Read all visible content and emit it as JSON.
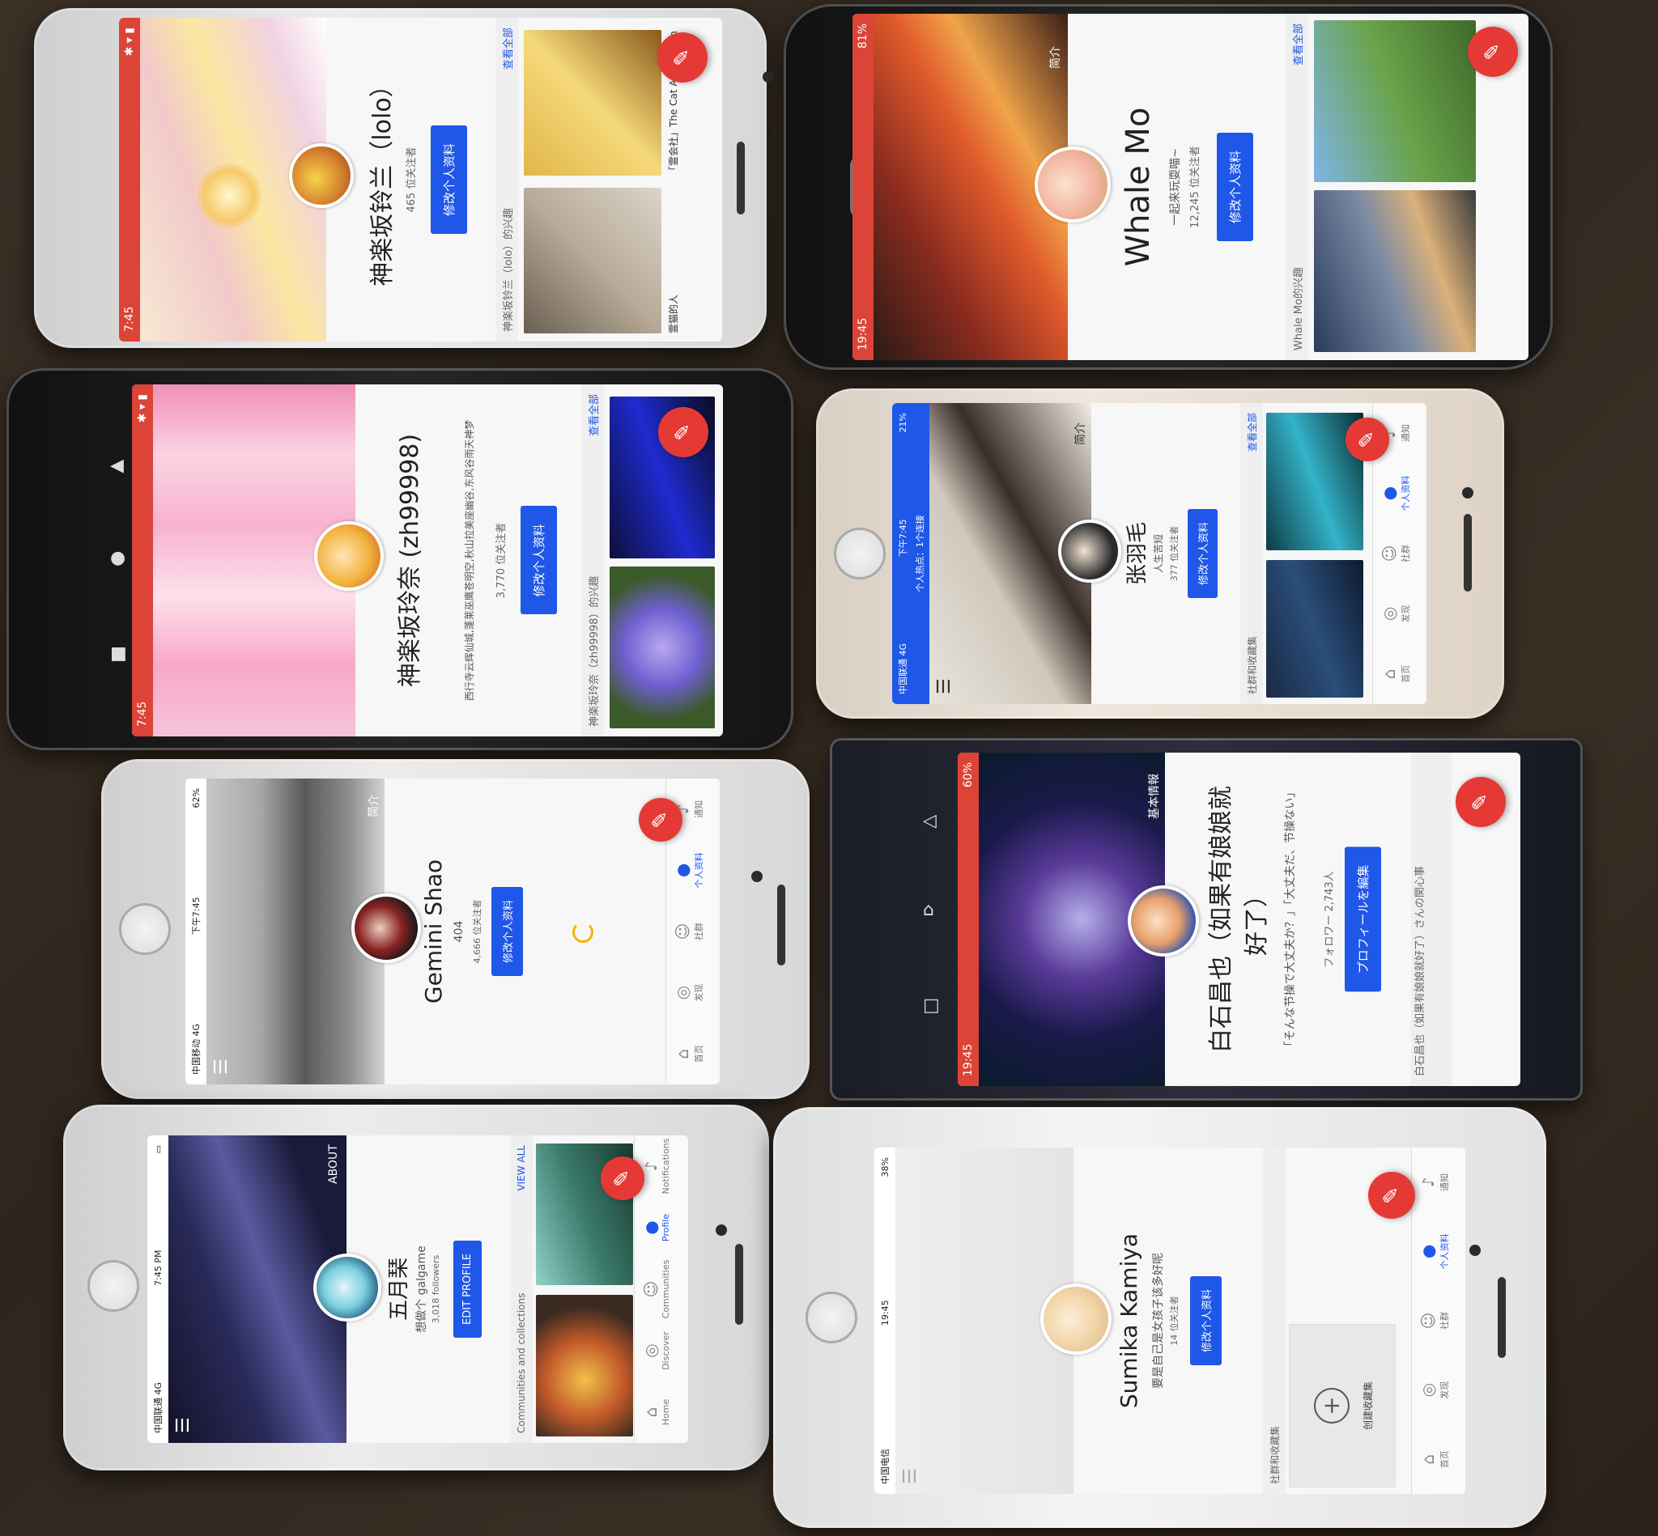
{
  "phones": [
    {
      "id": "p1",
      "status_time": "7:45",
      "name": "神楽坂铃兰（lolo）",
      "followers": "465 位关注者",
      "edit_label": "修改个人资料",
      "section_title": "神楽坂铃兰（lolo）的兴趣",
      "view_all": "查看全部",
      "community_label": "「霊会社」The Cat Association",
      "community_label2": "霊猫的人"
    },
    {
      "id": "p2",
      "status_time": "19:45",
      "status_battery": "81%",
      "name": "Whale Mo",
      "tagline": "一起来玩耍喵~",
      "followers": "12,245 位关注者",
      "edit_label": "修改个人资料",
      "section_title": "Whale Mo的兴趣",
      "view_all": "查看全部",
      "about": "简介"
    },
    {
      "id": "p3",
      "status_time": "7:45",
      "name": "神楽坂玲奈 (zh99998)",
      "tagline": "西行寺云辉仙城,蓬莱巫鹰苍明空,秋山拉美座幽谷,东风谷雨天神梦",
      "followers": "3,770 位关注者",
      "edit_label": "修改个人资料",
      "section_title": "神楽坂玲奈（zh99998）的兴趣",
      "view_all": "查看全部"
    },
    {
      "id": "p4",
      "status_carrier": "中国联通 4G",
      "status_time": "下午7:45",
      "status_hotspot": "个人热点：1个连接",
      "status_battery": "21%",
      "name": "张羽毛",
      "tagline": "人生苦短",
      "followers": "377 位关注者",
      "edit_label": "修改个人资料",
      "section_title": "社群和收藏集",
      "view_all": "查看全部",
      "about": "简介",
      "tabs": [
        "首页",
        "发现",
        "社群",
        "个人资料",
        "通知"
      ]
    },
    {
      "id": "p5",
      "status_carrier": "中国移动 4G",
      "status_time": "下午7:45",
      "status_battery": "62%",
      "name": "Gemini Shao",
      "tagline": "404",
      "followers": "4,666 位关注者",
      "edit_label": "修改个人资料",
      "about": "简介",
      "tabs": [
        "首页",
        "发现",
        "社群",
        "个人资料",
        "通知"
      ]
    },
    {
      "id": "p6",
      "status_time": "19:45",
      "status_battery": "60%",
      "name": "白石昌也（如果有娘娘就好了）",
      "tagline": "「そんな节操で大丈夫か？」「大丈夫だ、节操ない」",
      "followers": "フォロワー 2,743人",
      "edit_label": "プロフィールを編集",
      "section_title": "白石昌也（如果有娘娘就好了）さんの関心事",
      "about": "基本情報"
    },
    {
      "id": "p7",
      "status_carrier": "中国联通 4G",
      "status_time": "7:45 PM",
      "name": "五月琹",
      "tagline": "想做个 galgame",
      "followers": "3,018 followers",
      "edit_label": "EDIT PROFILE",
      "section_title": "Communities and collections",
      "view_all": "VIEW ALL",
      "about": "ABOUT",
      "tabs": [
        "Home",
        "Discover",
        "Communities",
        "Profile",
        "Notifications"
      ]
    },
    {
      "id": "p8",
      "status_carrier": "中国电信",
      "status_time": "19:45",
      "status_battery": "38%",
      "name": "Sumika Kamiya",
      "tagline": "要是自己是女孩子该多好呢",
      "followers": "14 位关注者",
      "edit_label": "修改个人资料",
      "section_title": "社群和收藏集",
      "create_label": "创建收藏集",
      "tabs": [
        "首页",
        "发现",
        "社群",
        "个人资料",
        "通知"
      ]
    }
  ],
  "colors": {
    "google_plus_red": "#db4437",
    "edit_blue": "#1f57e8",
    "fab_red": "#e53935"
  }
}
